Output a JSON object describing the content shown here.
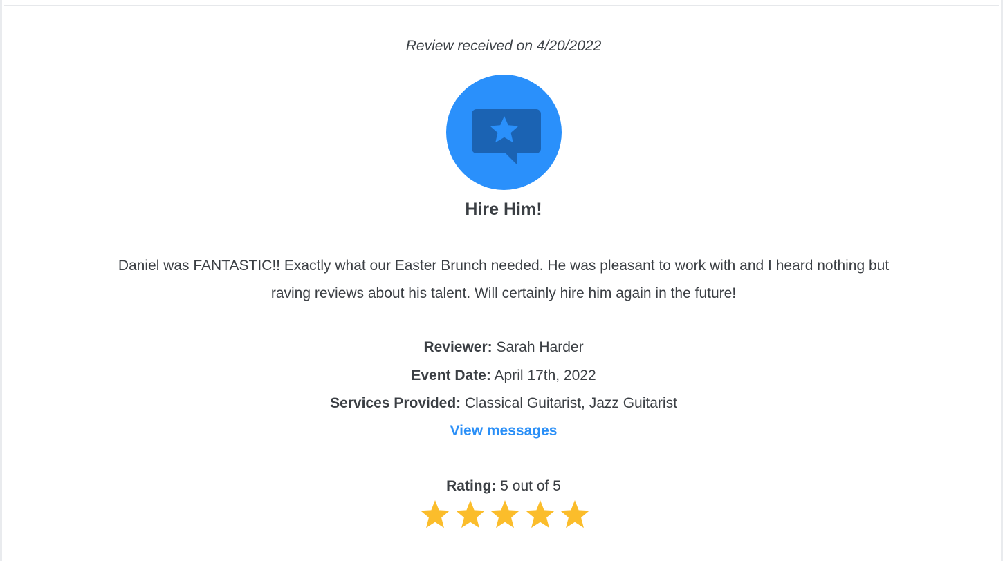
{
  "review": {
    "received_text": "Review received on 4/20/2022",
    "icon": "review-star-bubble-icon",
    "title": "Hire Him!",
    "body": "Daniel was FANTASTIC!! Exactly what our Easter Brunch needed. He was pleasant to work with and I heard nothing but raving reviews about his talent. Will certainly hire him again in the future!",
    "reviewer_label": "Reviewer:",
    "reviewer_value": "Sarah Harder",
    "event_date_label": "Event Date:",
    "event_date_value": "April 17th, 2022",
    "services_label": "Services Provided:",
    "services_value": "Classical Guitarist, Jazz Guitarist",
    "view_messages": "View messages",
    "rating_label": "Rating:",
    "rating_value": "5 out of 5",
    "rating_stars": 5,
    "rating_max": 5
  },
  "colors": {
    "accent_blue": "#2a90fb",
    "icon_dark_blue": "#1b63b3",
    "link_blue": "#2a8ff7",
    "star_gold": "#fbbd2b",
    "text": "#3b3f44"
  }
}
